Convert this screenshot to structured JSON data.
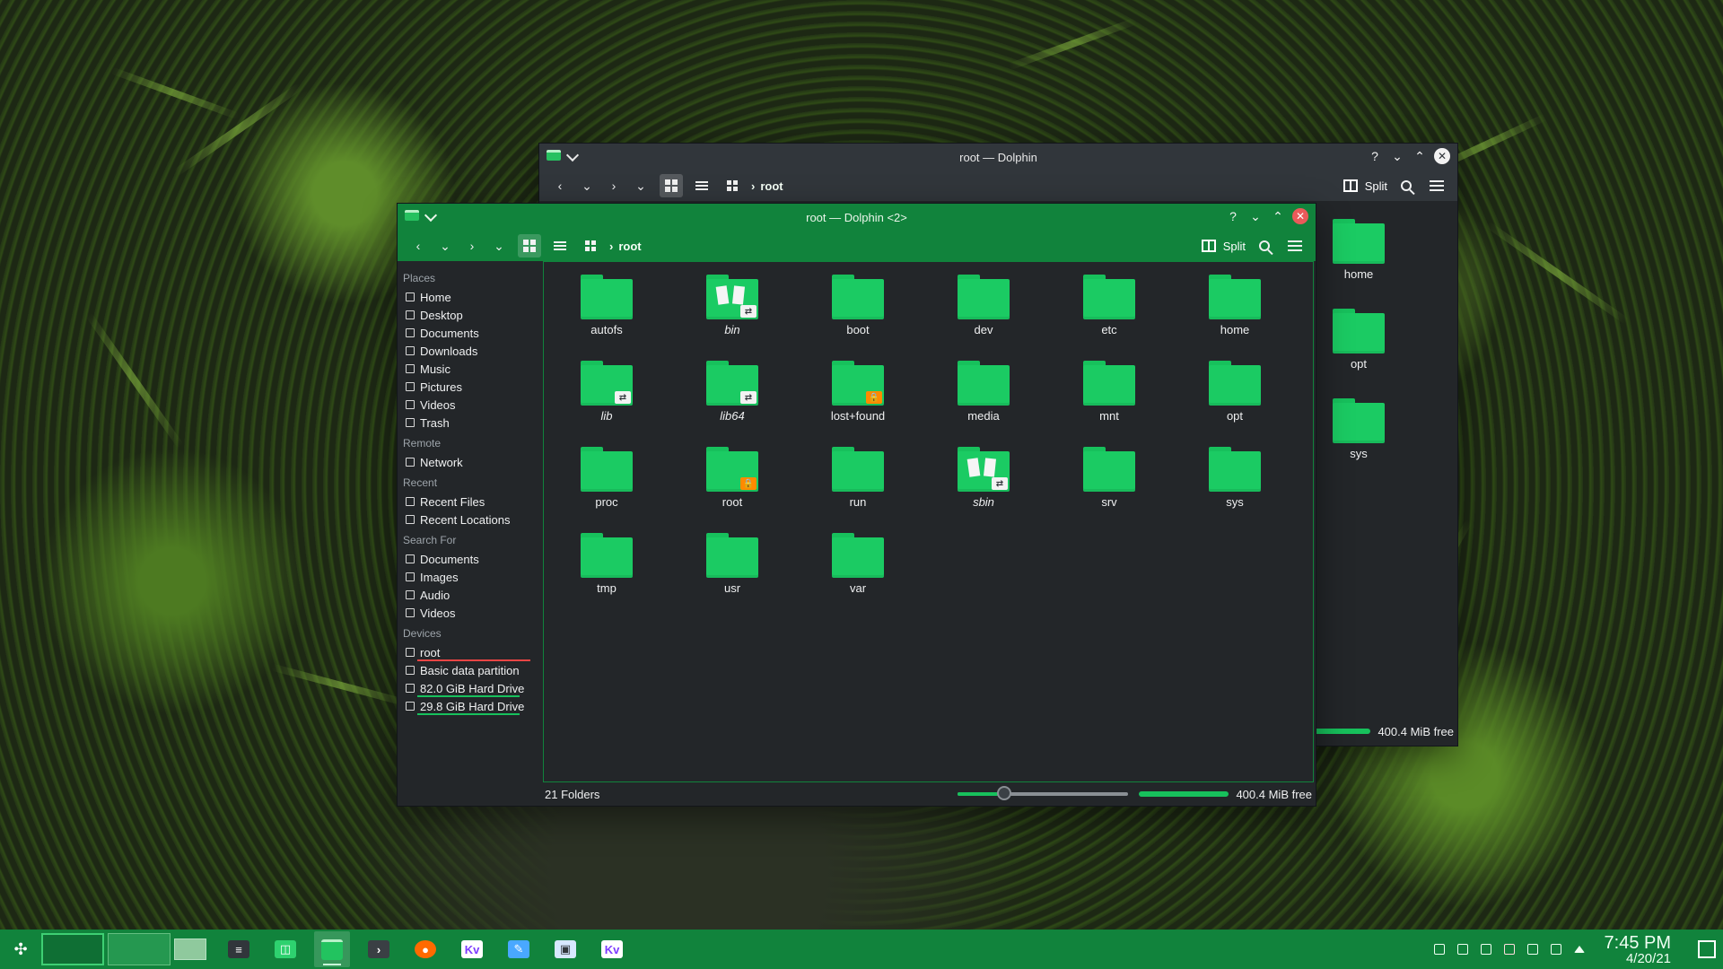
{
  "back_window": {
    "title": "root — Dolphin",
    "breadcrumb": "root",
    "split_label": "Split",
    "status_free": "400.4 MiB free",
    "visible_items": [
      "home",
      "opt",
      "sys"
    ]
  },
  "front_window": {
    "title": "root — Dolphin <2>",
    "breadcrumb": "root",
    "split_label": "Split",
    "places_title": "Places",
    "places": [
      {
        "label": "Home",
        "icon": "home-icon"
      },
      {
        "label": "Desktop",
        "icon": "desktop-icon"
      },
      {
        "label": "Documents",
        "icon": "documents-icon"
      },
      {
        "label": "Downloads",
        "icon": "downloads-icon"
      },
      {
        "label": "Music",
        "icon": "music-icon"
      },
      {
        "label": "Pictures",
        "icon": "pictures-icon"
      },
      {
        "label": "Videos",
        "icon": "videos-icon"
      },
      {
        "label": "Trash",
        "icon": "trash-icon"
      }
    ],
    "remote_title": "Remote",
    "remote": [
      {
        "label": "Network",
        "icon": "network-icon"
      }
    ],
    "recent_title": "Recent",
    "recent": [
      {
        "label": "Recent Files",
        "icon": "recent-files-icon"
      },
      {
        "label": "Recent Locations",
        "icon": "recent-locations-icon"
      }
    ],
    "search_title": "Search For",
    "search": [
      {
        "label": "Documents",
        "icon": "documents-icon"
      },
      {
        "label": "Images",
        "icon": "images-icon"
      },
      {
        "label": "Audio",
        "icon": "audio-icon"
      },
      {
        "label": "Videos",
        "icon": "videos-icon"
      }
    ],
    "devices_title": "Devices",
    "devices": [
      {
        "label": "root",
        "icon": "drive-icon"
      },
      {
        "label": "Basic data partition",
        "icon": "drive-icon"
      },
      {
        "label": "82.0 GiB Hard Drive",
        "icon": "drive-icon"
      },
      {
        "label": "29.8 GiB Hard Drive",
        "icon": "drive-icon"
      }
    ],
    "items": [
      {
        "label": "autofs"
      },
      {
        "label": "bin",
        "italic": true,
        "style": "docs-link"
      },
      {
        "label": "boot"
      },
      {
        "label": "dev"
      },
      {
        "label": "etc"
      },
      {
        "label": "home"
      },
      {
        "label": "lib",
        "italic": true,
        "style": "link"
      },
      {
        "label": "lib64",
        "italic": true,
        "style": "link"
      },
      {
        "label": "lost+found",
        "style": "lock"
      },
      {
        "label": "media"
      },
      {
        "label": "mnt"
      },
      {
        "label": "opt"
      },
      {
        "label": "proc"
      },
      {
        "label": "root",
        "style": "lock"
      },
      {
        "label": "run"
      },
      {
        "label": "sbin",
        "italic": true,
        "style": "docs-link"
      },
      {
        "label": "srv"
      },
      {
        "label": "sys"
      },
      {
        "label": "tmp"
      },
      {
        "label": "usr"
      },
      {
        "label": "var"
      }
    ],
    "status_count": "21 Folders",
    "status_free": "400.4 MiB free",
    "zoom_level": 0.27
  },
  "taskbar": {
    "clock_time": "7:45 PM",
    "clock_date": "4/20/21"
  },
  "colors": {
    "accent": "#11833c",
    "folder": "#1bcb63",
    "warning": "#ff8a00",
    "danger": "#e94545"
  }
}
